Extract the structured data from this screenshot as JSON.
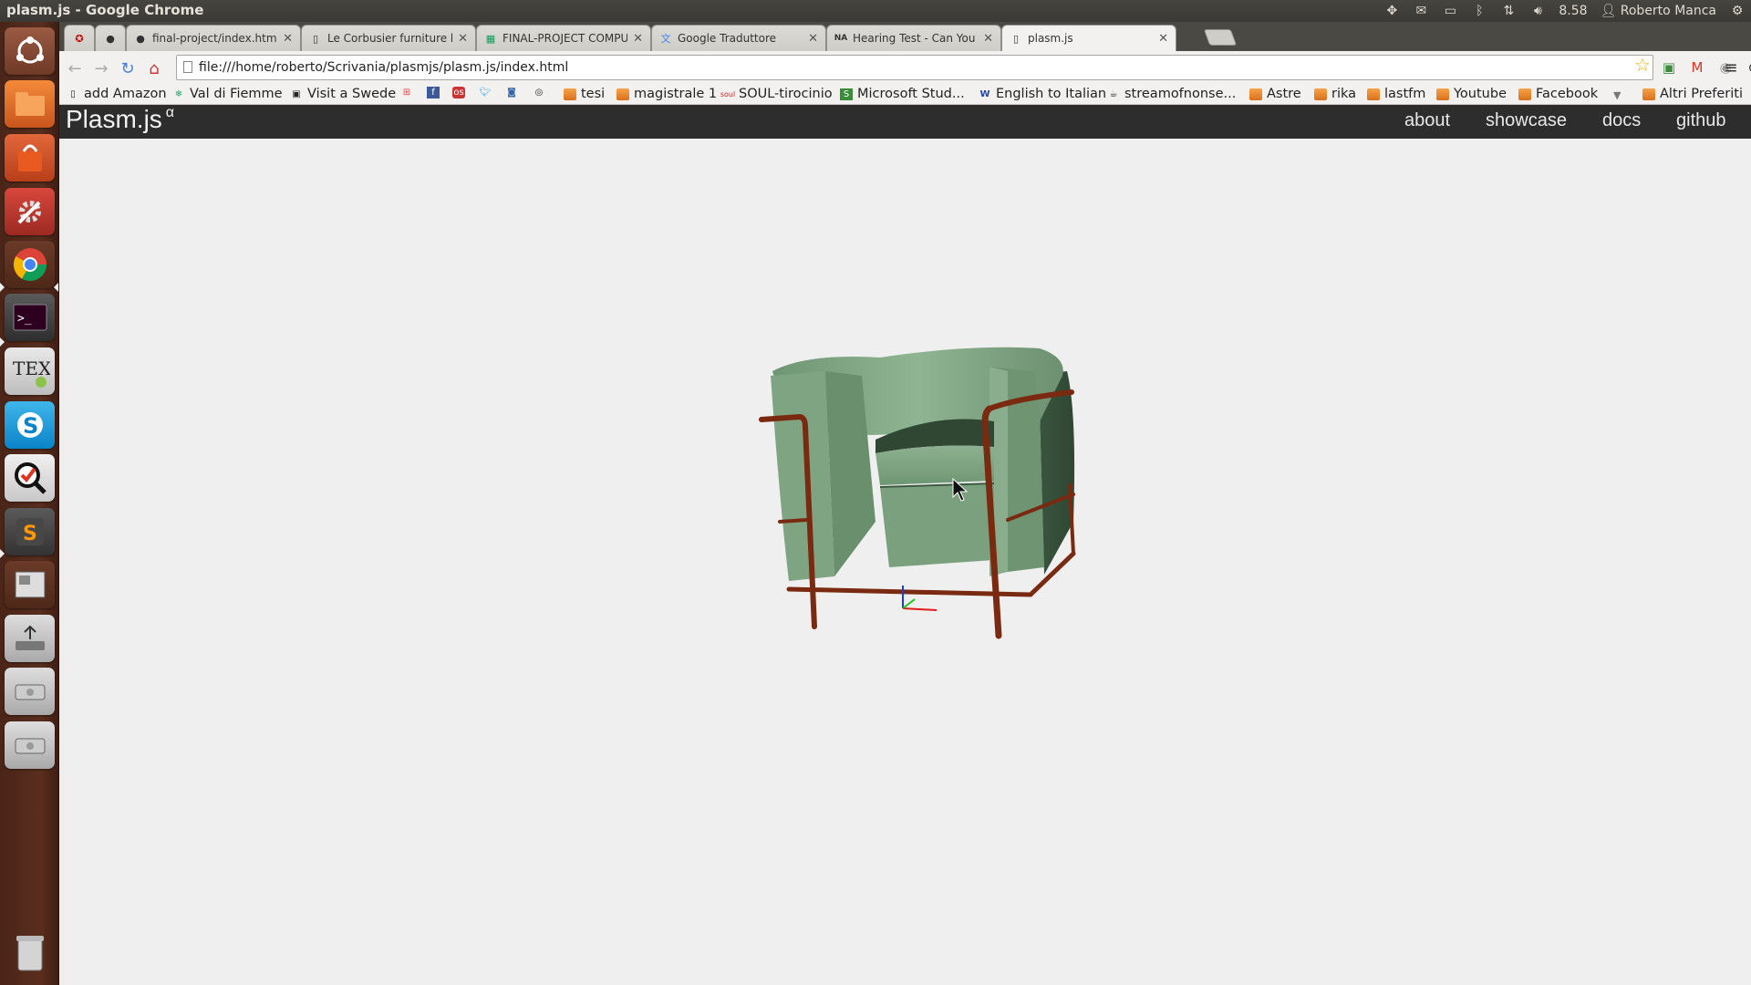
{
  "window": {
    "title": "plasm.js - Google Chrome"
  },
  "panel": {
    "clock": "8.58",
    "user": "Roberto Manca"
  },
  "tabs": [
    {
      "title": "",
      "icon": "pinned-app-icon"
    },
    {
      "title": "",
      "icon": "github-icon"
    },
    {
      "title": "final-project/index.html a",
      "icon": "github-icon"
    },
    {
      "title": "Le Corbusier furniture by",
      "icon": "page-icon"
    },
    {
      "title": "FINAL-PROJECT COMPUTI",
      "icon": "sheets-icon"
    },
    {
      "title": "Google Traduttore",
      "icon": "translate-icon"
    },
    {
      "title": "Hearing Test - Can You He",
      "icon": "na-icon"
    },
    {
      "title": "plasm.js",
      "icon": "page-icon"
    }
  ],
  "address": {
    "url": "file:///home/roberto/Scrivania/plasmjs/plasm.js/index.html"
  },
  "bookmarks": [
    {
      "label": "add Amazon",
      "icon": "page-icon"
    },
    {
      "label": "Val di Fiemme",
      "icon": "snowflake-icon"
    },
    {
      "label": "Visit a Swede",
      "icon": "site-icon"
    },
    {
      "label": "",
      "icon": "windows-icon"
    },
    {
      "label": "",
      "icon": "facebook-icon"
    },
    {
      "label": "",
      "icon": "os-icon"
    },
    {
      "label": "",
      "icon": "twitter-icon"
    },
    {
      "label": "",
      "icon": "camera-icon"
    },
    {
      "label": "",
      "icon": "feed-icon"
    },
    {
      "label": "tesi",
      "icon": "folder-icon"
    },
    {
      "label": "magistrale 1",
      "icon": "folder-icon"
    },
    {
      "label": "SOUL-tirocinio",
      "icon": "soul-icon"
    },
    {
      "label": "Microsoft Stud...",
      "icon": "microsoft-icon"
    },
    {
      "label": "English to Italian",
      "icon": "wr-icon"
    },
    {
      "label": "streamofnonse...",
      "icon": "blog-icon"
    },
    {
      "label": "Astre",
      "icon": "folder-icon"
    },
    {
      "label": "rika",
      "icon": "folder-icon"
    },
    {
      "label": "lastfm",
      "icon": "folder-icon"
    },
    {
      "label": "Youtube",
      "icon": "folder-icon"
    },
    {
      "label": "Facebook",
      "icon": "folder-icon"
    }
  ],
  "other_bookmarks": "Altri Preferiti",
  "site": {
    "brand": "Plasm.js",
    "brand_sup": "α",
    "nav": [
      "about",
      "showcase",
      "docs",
      "github"
    ]
  },
  "colors": {
    "chair_fabric": "#7fa382",
    "chair_frame": "#7a2a10",
    "navbar": "#2d2d2d",
    "canvas_bg": "#efefef"
  }
}
